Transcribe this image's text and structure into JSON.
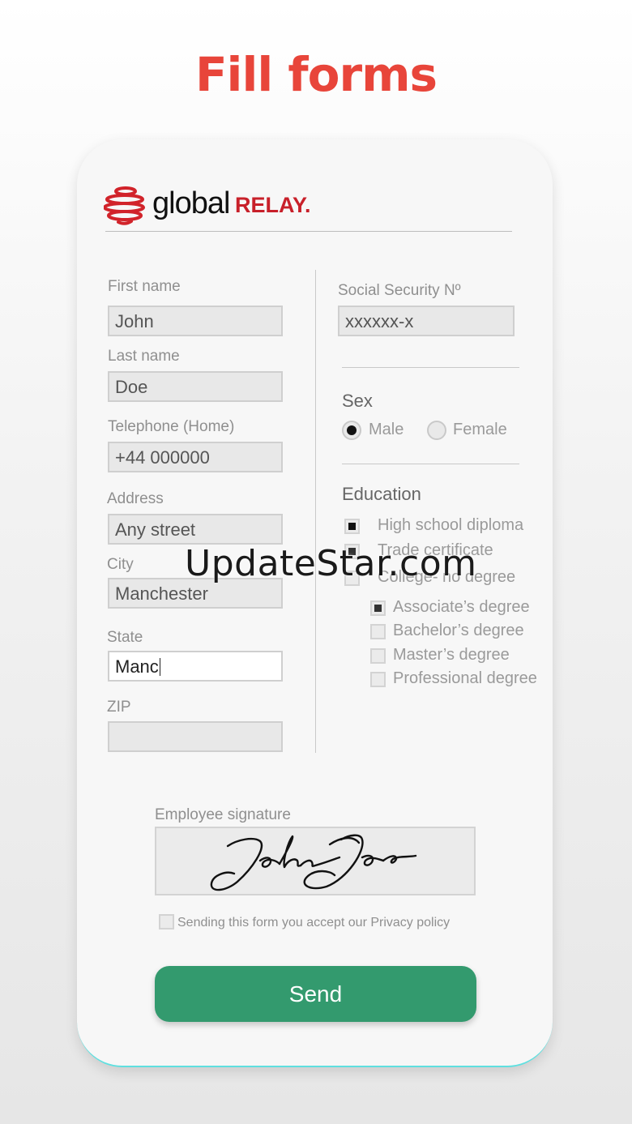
{
  "headline": "Fill forms",
  "logo": {
    "word1": "global",
    "word2": "RELAY."
  },
  "form": {
    "first_name": {
      "label": "First name",
      "value": "John"
    },
    "last_name": {
      "label": "Last name",
      "value": "Doe"
    },
    "telephone": {
      "label": "Telephone (Home)",
      "value": "+44 000000"
    },
    "address": {
      "label": "Address",
      "value": "Any street"
    },
    "city": {
      "label": "City",
      "value": "Manchester"
    },
    "state": {
      "label": "State",
      "value": "Manc"
    },
    "zip": {
      "label": "ZIP",
      "value": ""
    },
    "ssn": {
      "label": "Social Security Nº",
      "value": "xxxxxx-x"
    },
    "sex": {
      "title": "Sex",
      "options": [
        "Male",
        "Female"
      ],
      "selected": "Male"
    },
    "education": {
      "title": "Education",
      "options": [
        {
          "label": "High school diploma",
          "checked": true
        },
        {
          "label": "Trade certificate",
          "checked": true
        },
        {
          "label": "College- no degree",
          "checked": false
        },
        {
          "label": "Associate’s degree",
          "checked": true
        },
        {
          "label": "Bachelor’s degree",
          "checked": false
        },
        {
          "label": "Master’s degree",
          "checked": false
        },
        {
          "label": "Professional degree",
          "checked": false
        }
      ]
    },
    "signature": {
      "label": "Employee signature",
      "value": "John Doe"
    },
    "policy_text": "Sending this form you accept our Privacy policy",
    "send_label": "Send"
  },
  "watermark": "UpdateStar.com",
  "colors": {
    "headline": "#e8453a",
    "send": "#339a6e",
    "brand_red": "#c8202a"
  }
}
